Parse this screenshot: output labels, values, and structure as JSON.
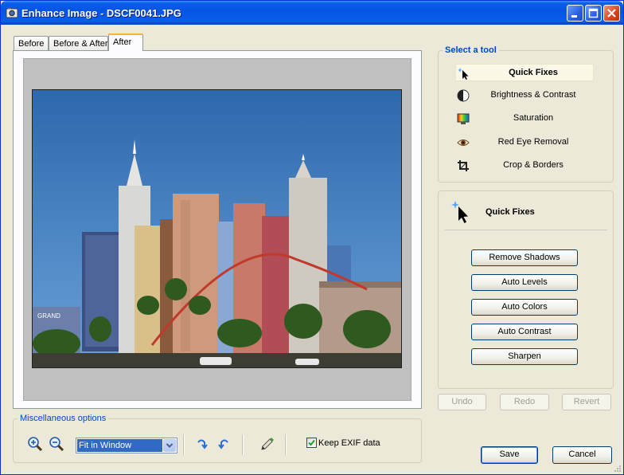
{
  "window": {
    "title": "Enhance Image - DSCF0041.JPG",
    "minimize": "_",
    "maximize": "□",
    "close": "✕"
  },
  "tabs": [
    {
      "label": "Before"
    },
    {
      "label": "Before & After"
    },
    {
      "label": "After",
      "active": true
    }
  ],
  "tool_panel": {
    "legend": "Select a tool",
    "tools": [
      {
        "label": "Quick Fixes",
        "icon": "cursor-sparkle-icon",
        "selected": true
      },
      {
        "label": "Brightness & Contrast",
        "icon": "contrast-icon"
      },
      {
        "label": "Saturation",
        "icon": "saturation-icon"
      },
      {
        "label": "Red Eye Removal",
        "icon": "eye-icon"
      },
      {
        "label": "Crop & Borders",
        "icon": "crop-icon"
      }
    ]
  },
  "quick_fixes": {
    "title": "Quick Fixes",
    "buttons": [
      "Remove Shadows",
      "Auto Levels",
      "Auto Colors",
      "Auto Contrast",
      "Sharpen"
    ]
  },
  "history": {
    "undo": "Undo",
    "redo": "Redo",
    "revert": "Revert"
  },
  "misc": {
    "legend": "Miscellaneous options",
    "zoom_select_value": "Fit in Window",
    "keep_exif_label": "Keep EXIF data",
    "keep_exif_checked": true
  },
  "dialog": {
    "save": "Save",
    "cancel": "Cancel"
  },
  "colors": {
    "accent": "#0046d5",
    "titlebar": "#0454e5",
    "selection": "#316ac5"
  }
}
